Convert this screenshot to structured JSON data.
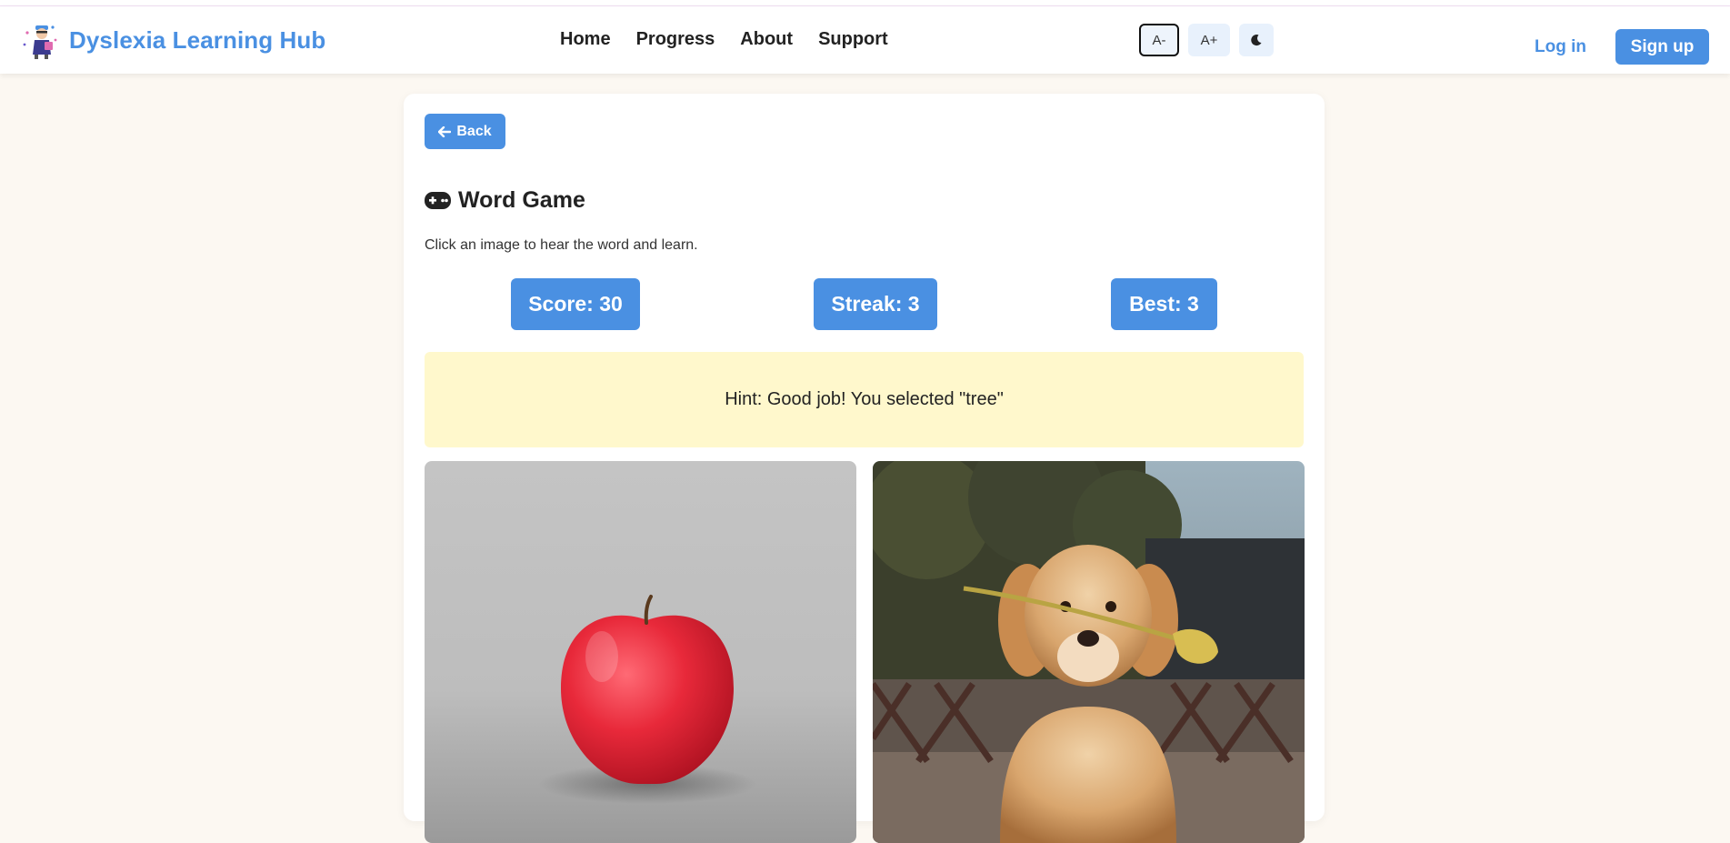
{
  "header": {
    "brand": "Dyslexia Learning Hub",
    "nav": [
      "Home",
      "Progress",
      "About",
      "Support"
    ],
    "font_decrease": "A-",
    "font_increase": "A+",
    "login": "Log in",
    "signup": "Sign up"
  },
  "game": {
    "back_label": "Back",
    "title": "Word Game",
    "instructions": "Click an image to hear the word and learn.",
    "score": "Score: 30",
    "streak": "Streak: 3",
    "best": "Best: 3",
    "hint": "Hint: Good job! You selected \"tree\"",
    "images": [
      {
        "subject": "apple"
      },
      {
        "subject": "dog"
      }
    ]
  },
  "colors": {
    "accent": "#4a90e2",
    "page_background": "#fcf8f2",
    "hint_background": "#fff8cc"
  },
  "icons": [
    "gamepad-icon",
    "arrow-left-icon",
    "moon-icon",
    "brand-logo"
  ]
}
